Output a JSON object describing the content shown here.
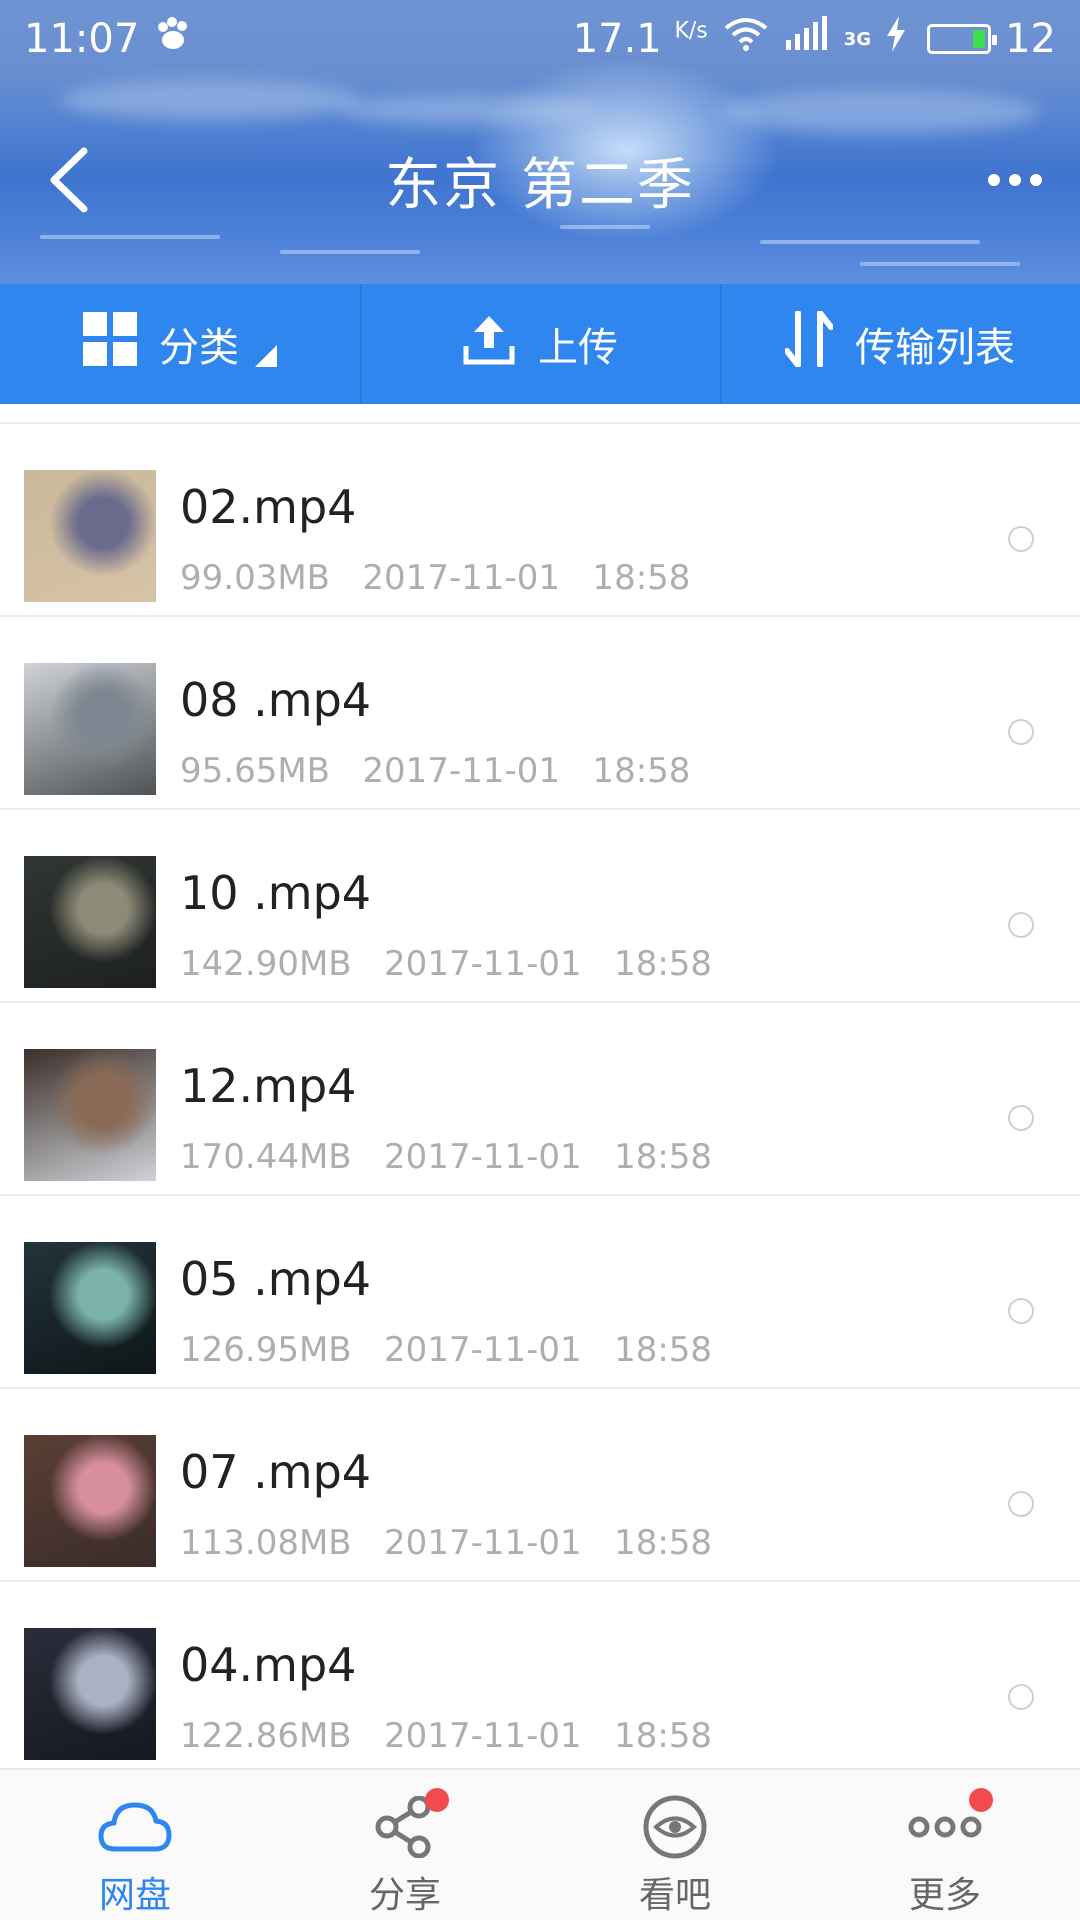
{
  "status_bar": {
    "time": "11:07",
    "net_speed": "17.1",
    "net_unit": "K/s",
    "network_type": "3G",
    "battery_level": "12"
  },
  "header": {
    "title": "东京 第二季"
  },
  "toolbar": {
    "category_label": "分类",
    "upload_label": "上传",
    "transfer_label": "传输列表"
  },
  "files": [
    {
      "name": "02.mp4",
      "meta": "99.03MB   2017-11-01   18:58",
      "thumb_colors": [
        "#c9b89a",
        "#6a6a8c",
        "#d7c3a6"
      ]
    },
    {
      "name": "08 .mp4",
      "meta": "95.65MB   2017-11-01   18:58",
      "thumb_colors": [
        "#cfd3d8",
        "#7e8791",
        "#4f5355"
      ]
    },
    {
      "name": "10 .mp4",
      "meta": "142.90MB   2017-11-01   18:58",
      "thumb_colors": [
        "#303634",
        "#8d8a78",
        "#1d201f"
      ]
    },
    {
      "name": "12.mp4",
      "meta": "170.44MB   2017-11-01   18:58",
      "thumb_colors": [
        "#3b2f2a",
        "#8a6a56",
        "#cfd2d8"
      ]
    },
    {
      "name": "05 .mp4",
      "meta": "126.95MB   2017-11-01   18:58",
      "thumb_colors": [
        "#22343a",
        "#7bb3a8",
        "#0e1619"
      ]
    },
    {
      "name": "07 .mp4",
      "meta": "113.08MB   2017-11-01   18:58",
      "thumb_colors": [
        "#5a3f34",
        "#d78fa0",
        "#3a2c29"
      ]
    },
    {
      "name": "04.mp4",
      "meta": "122.86MB   2017-11-01   18:58",
      "thumb_colors": [
        "#2a2d3a",
        "#a9b1c2",
        "#151820"
      ]
    }
  ],
  "bottom_nav": {
    "items": [
      {
        "label": "网盘",
        "icon": "cloud-icon",
        "active": true,
        "badge": false
      },
      {
        "label": "分享",
        "icon": "share-icon",
        "active": false,
        "badge": true
      },
      {
        "label": "看吧",
        "icon": "eye-icon",
        "active": false,
        "badge": false
      },
      {
        "label": "更多",
        "icon": "more-dots-icon",
        "active": false,
        "badge": true
      }
    ]
  },
  "colors": {
    "toolbar_blue": "#2f86ee",
    "active_tab": "#2f86ee",
    "badge_red": "#f24b4b"
  }
}
